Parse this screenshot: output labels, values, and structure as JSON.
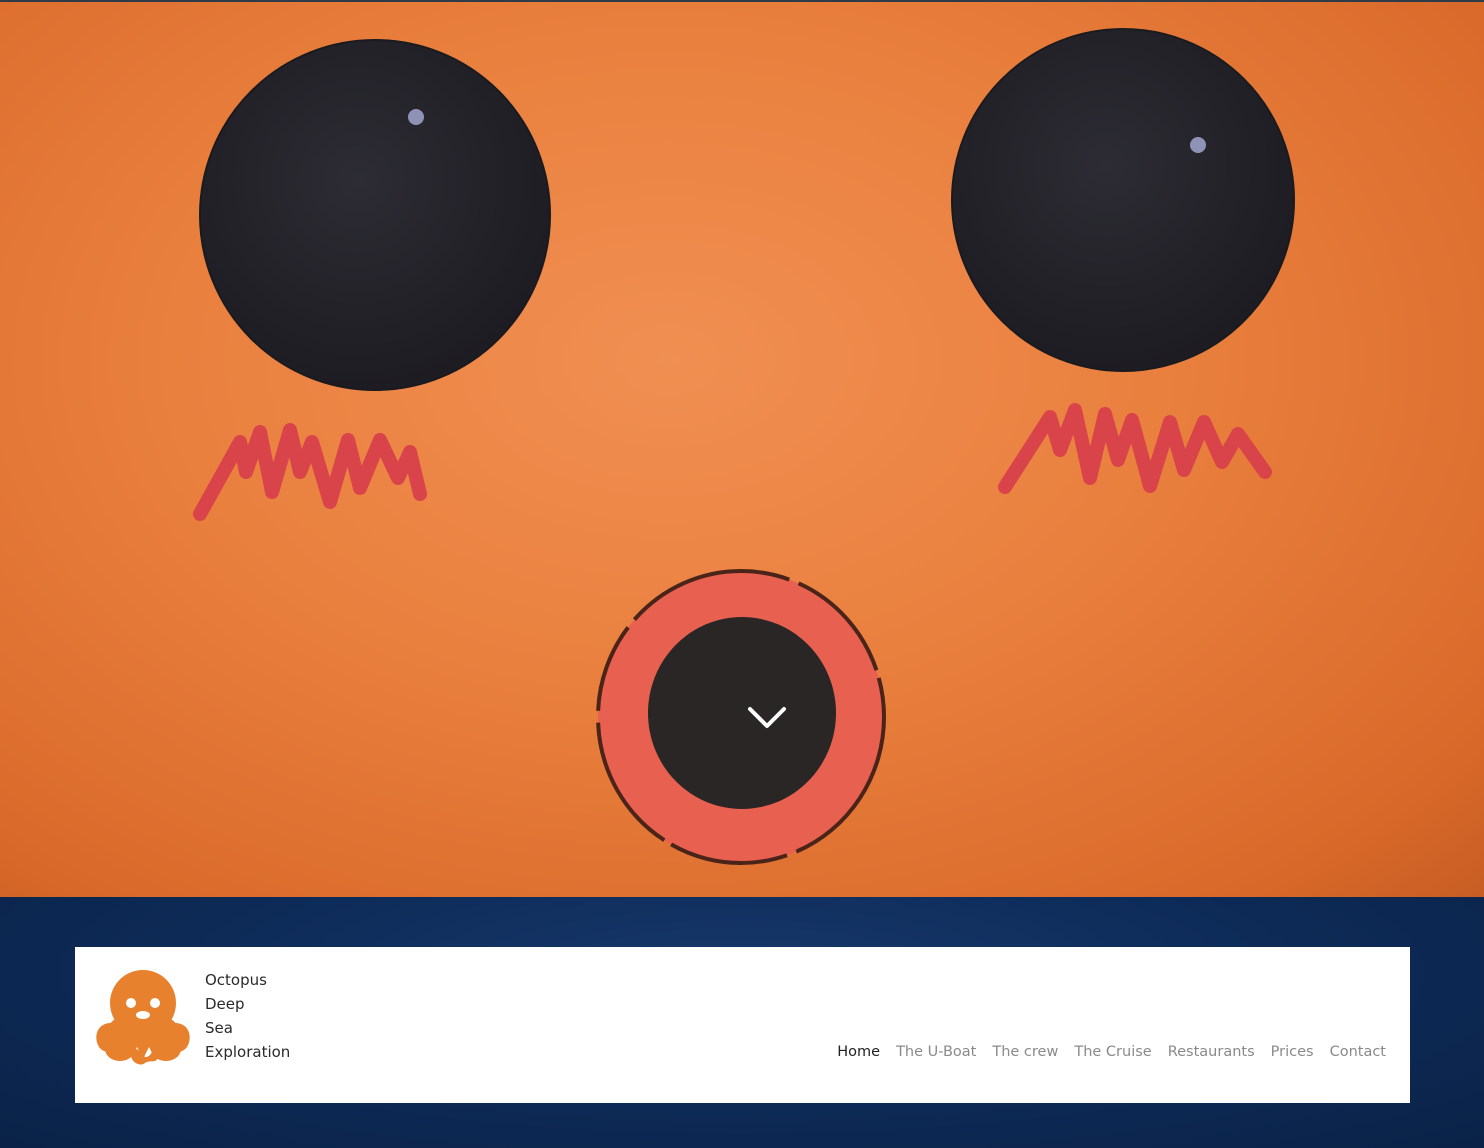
{
  "brand": {
    "name_lines": [
      "Octopus",
      "Deep",
      "Sea",
      "Exploration"
    ],
    "logo_icon": "octopus-icon",
    "logo_color": "#e8812d"
  },
  "nav": {
    "items": [
      {
        "label": "Home",
        "active": true
      },
      {
        "label": "The U-Boat",
        "active": false
      },
      {
        "label": "The crew",
        "active": false
      },
      {
        "label": "The Cruise",
        "active": false
      },
      {
        "label": "Restaurants",
        "active": false
      },
      {
        "label": "Prices",
        "active": false
      },
      {
        "label": "Contact",
        "active": false
      }
    ]
  },
  "hero": {
    "scroll_icon": "chevron-down-icon",
    "background_color": "#ea8443",
    "eye_color": "#23222a",
    "cheek_color": "#d9434a",
    "mouth_ring_color": "#e8604f"
  },
  "colors": {
    "sea": "#0d2a56",
    "nav_active": "#222222",
    "nav_inactive": "#8a8a8a"
  }
}
